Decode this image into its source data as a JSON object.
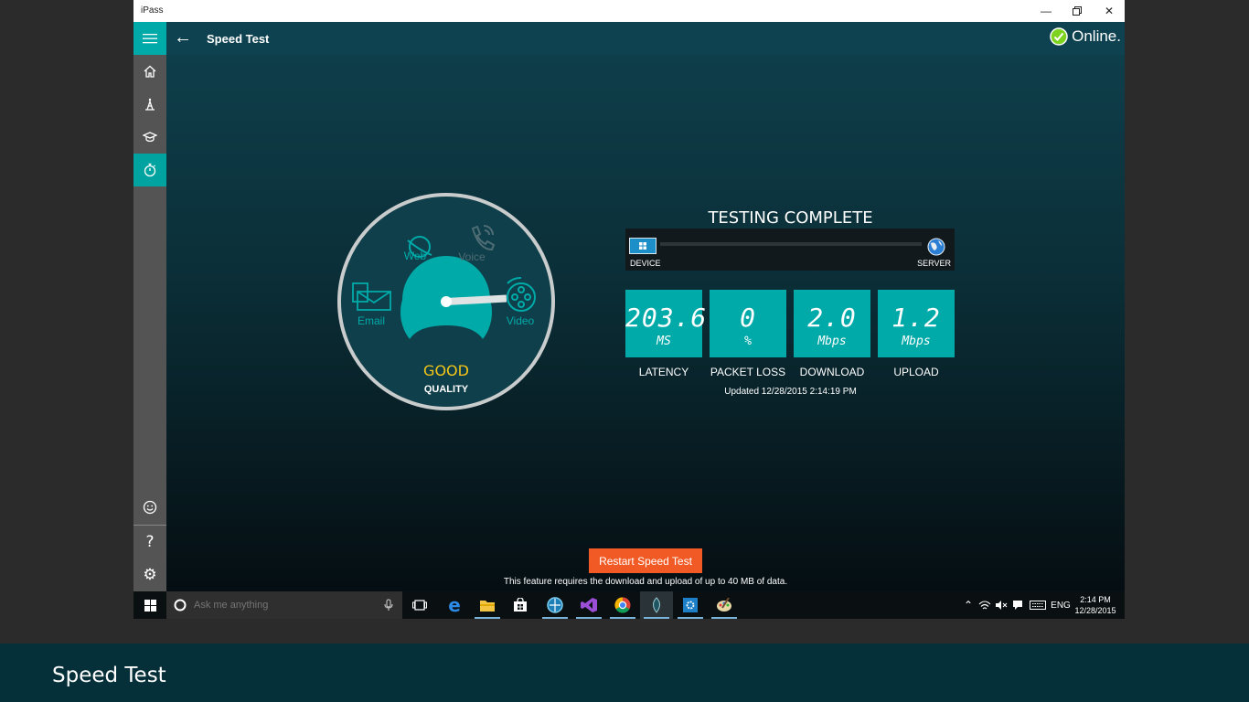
{
  "window": {
    "title": "iPass"
  },
  "appbar": {
    "page_title": "Speed Test",
    "status": "Online."
  },
  "dial": {
    "categories": {
      "web": "Web",
      "voice": "Voice",
      "email": "Email",
      "video": "Video"
    },
    "rating": "GOOD",
    "rating_label": "QUALITY"
  },
  "test": {
    "heading": "TESTING COMPLETE",
    "device_label": "DEVICE",
    "server_label": "SERVER",
    "metrics": [
      {
        "value": "203.6",
        "unit": "MS",
        "label": "LATENCY"
      },
      {
        "value": "0",
        "unit": "%",
        "label": "PACKET LOSS"
      },
      {
        "value": "2.0",
        "unit": "Mbps",
        "label": "DOWNLOAD"
      },
      {
        "value": "1.2",
        "unit": "Mbps",
        "label": "UPLOAD"
      }
    ],
    "updated": "Updated 12/28/2015 2:14:19 PM"
  },
  "actions": {
    "restart_label": "Restart Speed Test",
    "disclaimer": "This feature requires the download and upload of up to 40 MB of data."
  },
  "taskbar": {
    "search_placeholder": "Ask me anything",
    "language": "ENG",
    "time": "2:14 PM",
    "date": "12/28/2015"
  },
  "caption": "Speed Test",
  "colors": {
    "accent": "#00aaa8",
    "rating": "#f5c518",
    "restart": "#f15a24",
    "online": "#7ed321"
  }
}
